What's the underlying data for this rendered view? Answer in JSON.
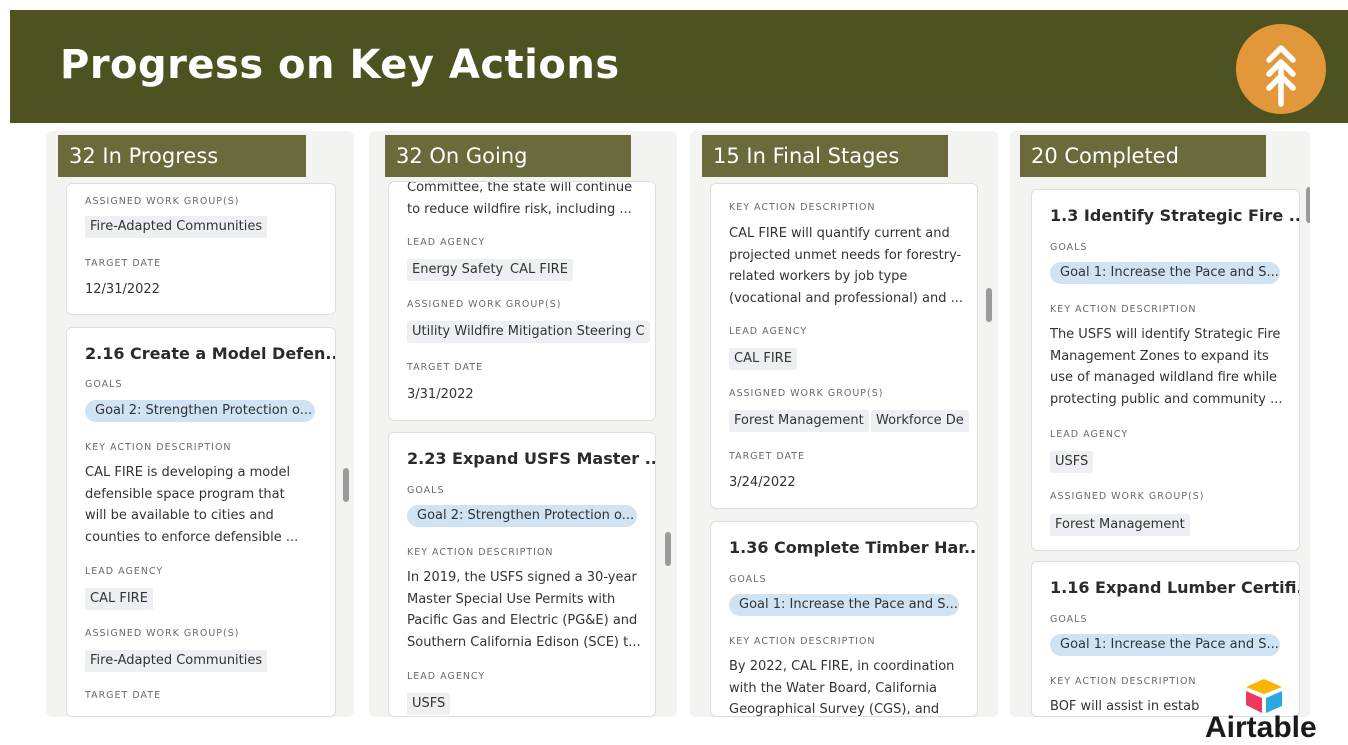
{
  "slide_title": "Progress on Key Actions",
  "brand": "Airtable",
  "colors": {
    "banner": "#4e5120",
    "column_header": "#6b6a3a",
    "logo": "#e2973a",
    "goal_pill": "#cfe3f3"
  },
  "labels": {
    "goals": "GOALS",
    "key_action_description": "KEY ACTION DESCRIPTION",
    "lead_agency": "LEAD AGENCY",
    "assigned_work_groups": "ASSIGNED WORK GROUP(S)",
    "target_date": "TARGET DATE"
  },
  "columns": [
    {
      "header": "32 In Progress",
      "card1": {
        "work_group": "Fire-Adapted Communities",
        "target_date": "12/31/2022"
      },
      "card2": {
        "title": "2.16 Create a Model Defen...",
        "goal": "Goal 2: Strengthen Protection o...",
        "desc": [
          "CAL FIRE is developing a model",
          "defensible space program that",
          "will be available to cities and",
          "counties to enforce defensible ..."
        ],
        "lead_agency": "CAL FIRE",
        "work_group": "Fire-Adapted Communities"
      }
    },
    {
      "header": "32 On Going",
      "card1": {
        "desc": [
          "Committee, the state will continue",
          "to reduce wildfire risk, including ..."
        ],
        "lead_agencies": [
          "Energy Safety",
          "CAL FIRE"
        ],
        "work_group": "Utility Wildfire Mitigation Steering C",
        "target_date": "3/31/2022"
      },
      "card2": {
        "title": "2.23 Expand USFS Master ...",
        "goal": "Goal 2: Strengthen Protection o...",
        "desc": [
          "In 2019, the USFS signed a 30-year",
          "Master Special Use Permits with",
          "Pacific Gas and Electric (PG&E) and",
          "Southern California Edison (SCE) t..."
        ],
        "lead_agency": "USFS"
      }
    },
    {
      "header": "15 In Final Stages",
      "card1": {
        "desc": [
          "CAL FIRE will quantify current and",
          "projected unmet needs for forestry-",
          "related workers by job type",
          "(vocational and professional) and ..."
        ],
        "lead_agency": "CAL FIRE",
        "work_groups": [
          "Forest Management",
          "Workforce De"
        ],
        "target_date": "3/24/2022"
      },
      "card2": {
        "title": "1.36 Complete Timber Har...",
        "goal": "Goal 1: Increase the Pace and S...",
        "desc": [
          "By 2022, CAL FIRE, in coordination",
          "with the Water Board, California",
          "Geographical Survey (CGS), and"
        ]
      }
    },
    {
      "header": "20 Completed",
      "card1": {
        "title": "1.3 Identify Strategic Fire ...",
        "goal": "Goal 1: Increase the Pace and S...",
        "desc": [
          "The USFS will identify Strategic Fire",
          "Management Zones to expand its",
          "use of managed wildland fire while",
          "protecting public and community ..."
        ],
        "lead_agency": "USFS",
        "work_group": "Forest Management"
      },
      "card2": {
        "title": "1.16 Expand Lumber Certifi...",
        "goal": "Goal 1: Increase the Pace and S...",
        "desc": [
          "BOF will assist in estab"
        ]
      }
    }
  ]
}
